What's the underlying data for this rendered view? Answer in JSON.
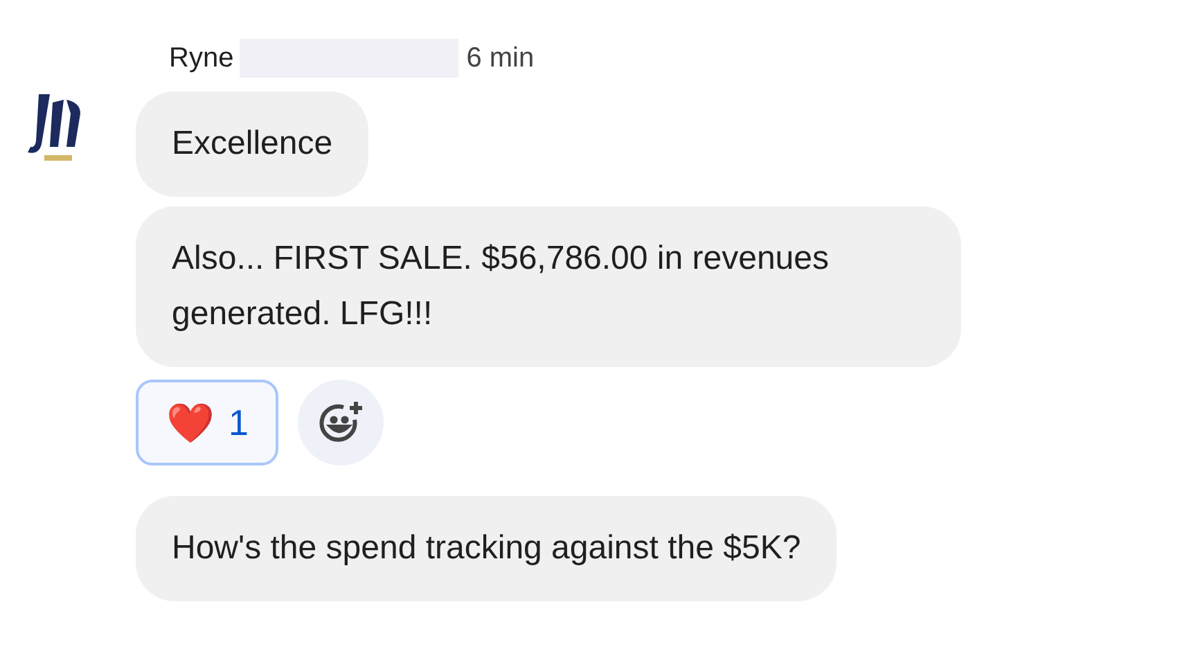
{
  "sender": {
    "name": "Ryne",
    "time": "6 min",
    "redacted": true
  },
  "messages": [
    {
      "text": "Excellence"
    },
    {
      "text": "Also... FIRST SALE. $56,786.00 in revenues generated. LFG!!!",
      "reactions": [
        {
          "emoji": "❤️",
          "count": "1",
          "selected": true
        }
      ]
    },
    {
      "text": "How's the spend tracking against the $5K?"
    }
  ]
}
